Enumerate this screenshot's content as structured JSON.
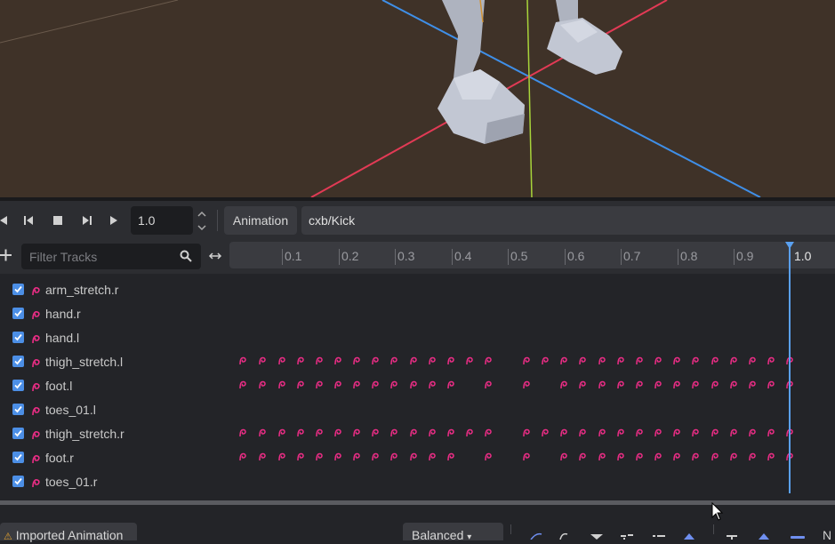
{
  "viewport": {
    "background": "#3f3228"
  },
  "playback": {
    "speed_value": "1.0",
    "animation_button": "Animation",
    "animation_name": "cxb/Kick"
  },
  "track_toolbar": {
    "filter_placeholder": "Filter Tracks"
  },
  "timeline": {
    "ticks": [
      "0.1",
      "0.2",
      "0.3",
      "0.4",
      "0.5",
      "0.6",
      "0.7",
      "0.8",
      "0.9"
    ],
    "current_time": "1.0",
    "playhead_color": "#5aa0f0"
  },
  "tracks": [
    {
      "name": "arm_stretch.r",
      "checked": true
    },
    {
      "name": "hand.r",
      "checked": true
    },
    {
      "name": "hand.l",
      "checked": true
    },
    {
      "name": "thigh_stretch.l",
      "checked": true
    },
    {
      "name": "foot.l",
      "checked": true
    },
    {
      "name": "toes_01.l",
      "checked": true
    },
    {
      "name": "thigh_stretch.r",
      "checked": true
    },
    {
      "name": "foot.r",
      "checked": true
    },
    {
      "name": "toes_01.r",
      "checked": true
    }
  ],
  "key_color": "#ec2d86",
  "bottom_bar": {
    "imported_label": "Imported Animation",
    "balanced_label": "Balanced"
  }
}
